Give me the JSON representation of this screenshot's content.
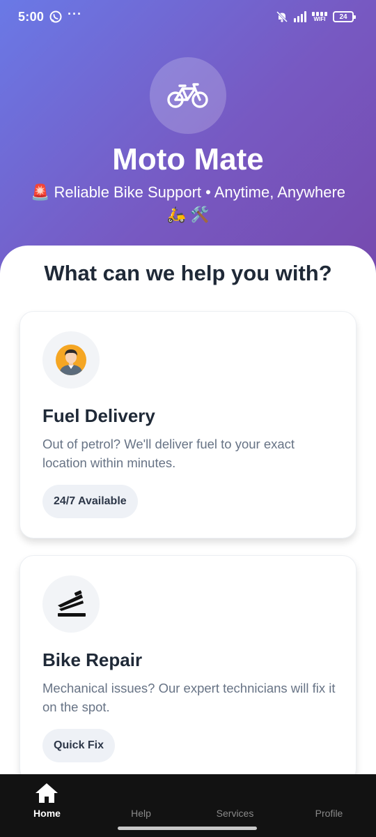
{
  "status_bar": {
    "time": "5:00",
    "dots": "···",
    "wifi_label": "WIFI",
    "battery_level": "24",
    "icons": [
      "whatsapp-icon",
      "bell-off-icon",
      "signal-icon",
      "wifi-icon",
      "battery-icon"
    ]
  },
  "header": {
    "logo_icon": "bicycle-icon",
    "title": "Moto Mate",
    "tagline": "🚨 Reliable Bike Support • Anytime, Anywhere 🛵 🛠️"
  },
  "section": {
    "title": "What can we help you with?"
  },
  "services": [
    {
      "icon": "delivery-person-icon",
      "title": "Fuel Delivery",
      "description": "Out of petrol? We'll deliver fuel to your exact location within minutes.",
      "badge": "24/7 Available"
    },
    {
      "icon": "repair-tool-icon",
      "title": "Bike Repair",
      "description": "Mechanical issues? Our expert technicians will fix it on the spot.",
      "badge": "Quick Fix"
    }
  ],
  "bottom_nav": {
    "active": "Home",
    "items": [
      {
        "label": "Home",
        "icon": "home-icon"
      },
      {
        "label": "Help"
      },
      {
        "label": "Services"
      },
      {
        "label": "Profile"
      }
    ]
  },
  "colors": {
    "gradient_start": "#6a79e6",
    "gradient_end": "#7649ad",
    "nav_background": "#121212",
    "text_dark": "#1f2937",
    "text_muted": "#677385"
  }
}
